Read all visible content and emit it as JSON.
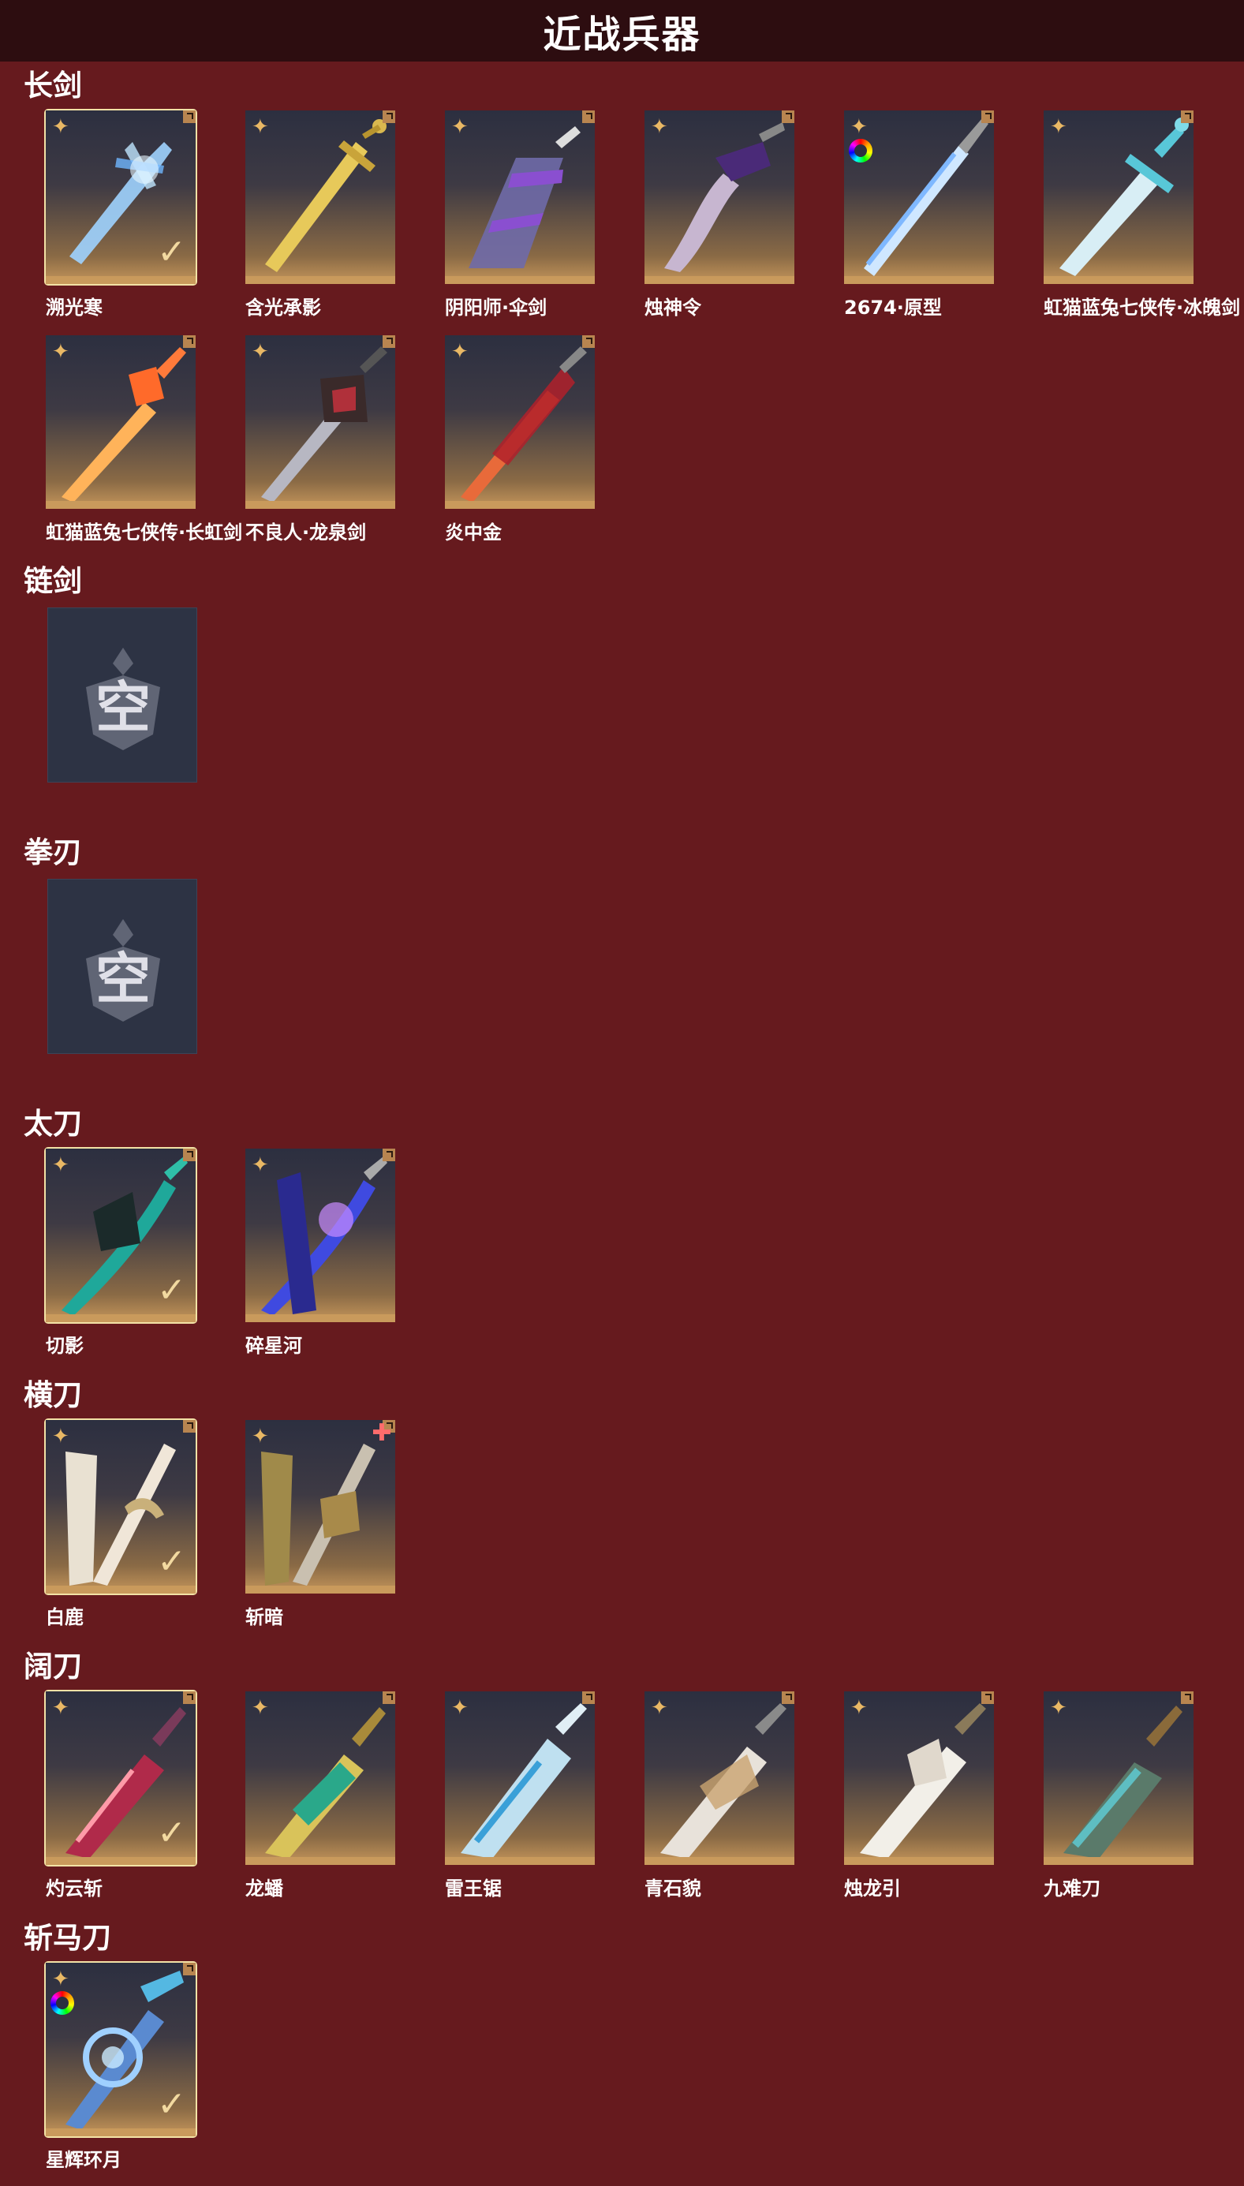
{
  "header": {
    "title": "近战兵器"
  },
  "sections": {
    "long_sword": {
      "title": "长剑",
      "items": [
        "溯光寒",
        "含光承影",
        "阴阳师·伞剑",
        "烛神令",
        "2674·原型",
        "虹猫蓝兔七侠传·冰魄剑",
        "虹猫蓝兔七侠传·长虹剑",
        "不良人·龙泉剑",
        "炎中金"
      ]
    },
    "chain_sword": {
      "title": "链剑",
      "empty_label": "空"
    },
    "fist_blade": {
      "title": "拳刃",
      "empty_label": "空"
    },
    "tachi": {
      "title": "太刀",
      "items": [
        "切影",
        "碎星河"
      ]
    },
    "horizontal_blade": {
      "title": "横刀",
      "items": [
        "白鹿",
        "斩暗"
      ]
    },
    "broad_blade": {
      "title": "阔刀",
      "items": [
        "灼云斩",
        "龙蟠",
        "雷王锯",
        "青石貌",
        "烛龙引",
        "九难刀"
      ]
    },
    "horse_blade": {
      "title": "斩马刀",
      "items": [
        "星辉环月"
      ]
    }
  },
  "icons": {
    "star": "✦",
    "check": "✓",
    "plus": "✚"
  },
  "colors": {
    "background": "#661a1e",
    "header_bg": "#2d0d10",
    "card_frame": "#c99a5c",
    "equipped_outline": "#f3e2a6",
    "star": "#e9b865"
  }
}
